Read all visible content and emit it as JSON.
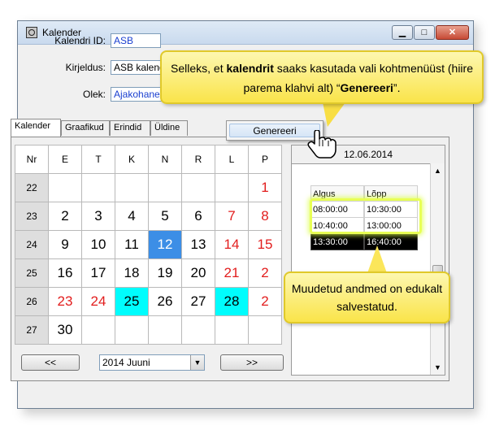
{
  "window": {
    "title": "Kalender"
  },
  "form": {
    "id_label": "Kalendri ID:",
    "id_value": "ASB",
    "desc_label": "Kirjeldus:",
    "desc_value": "ASB kalender",
    "state_label": "Olek:",
    "state_value": "Ajakohane"
  },
  "tabs": [
    "Kalender",
    "Graafikud",
    "Erindid",
    "Üldine"
  ],
  "calendar": {
    "headers": [
      "Nr",
      "E",
      "T",
      "K",
      "N",
      "R",
      "L",
      "P"
    ],
    "rows": [
      [
        "22",
        "",
        "",
        "",
        "",
        "",
        "",
        "1"
      ],
      [
        "23",
        "2",
        "3",
        "4",
        "5",
        "6",
        "7",
        "8"
      ],
      [
        "24",
        "9",
        "10",
        "11",
        "12",
        "13",
        "14",
        "15"
      ],
      [
        "25",
        "16",
        "17",
        "18",
        "19",
        "20",
        "21",
        "2"
      ],
      [
        "26",
        "23",
        "24",
        "25",
        "26",
        "27",
        "28",
        "2"
      ],
      [
        "27",
        "30",
        "",
        "",
        "",
        "",
        "",
        ""
      ]
    ],
    "month_select": "2014 Juuni",
    "prev_label": "<<",
    "next_label": ">>",
    "colors": {
      "weekend": "#e21d1d",
      "selected": "#3c8ee6",
      "highlight": "#00fdfd"
    }
  },
  "day": {
    "date": "12.06.2014",
    "col_start": "Algus",
    "col_end": "Lõpp",
    "entries": [
      {
        "start": "08:00:00",
        "end": "10:30:00"
      },
      {
        "start": "10:40:00",
        "end": "13:00:00"
      },
      {
        "start": "13:30:00",
        "end": "16:40:00"
      }
    ]
  },
  "context_menu": {
    "item": "Genereeri"
  },
  "callouts": {
    "top_1": "Selleks, et ",
    "top_2": "kalendrit",
    "top_3": " saaks kasutada vali kohtmenüüst (hiire parema klahvi alt) “",
    "top_4": "Genereeri",
    "top_5": "”.",
    "bottom": "Muudetud andmed on edukalt salvestatud."
  }
}
